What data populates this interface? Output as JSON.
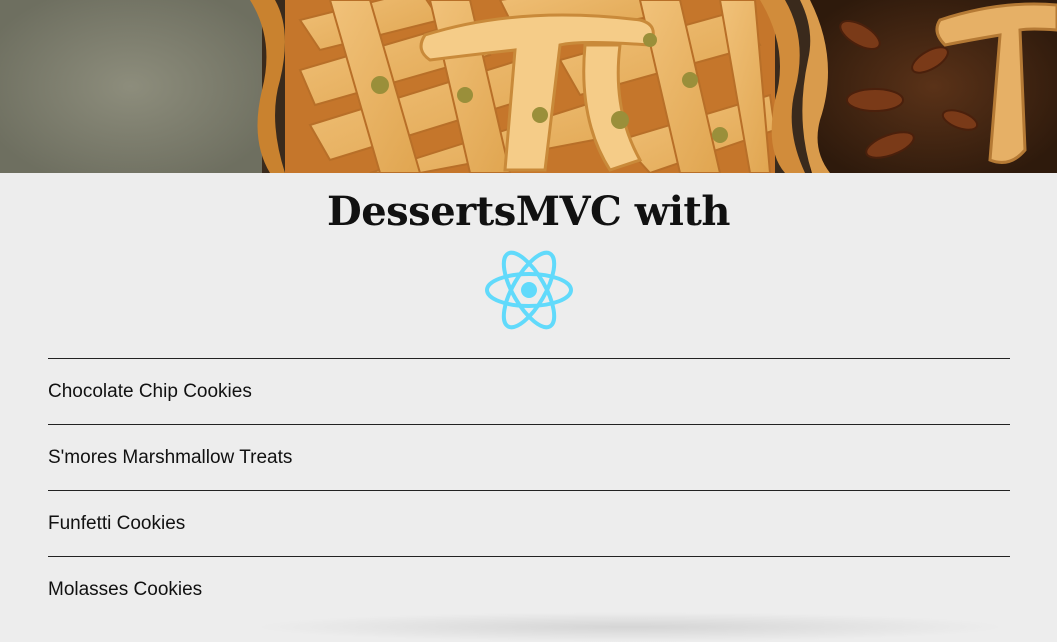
{
  "header": {
    "title": "DessertsMVC with",
    "logo_icon": "react-atom-icon",
    "logo_color": "#61dafb"
  },
  "desserts": [
    {
      "label": "Chocolate Chip Cookies"
    },
    {
      "label": "S'mores Marshmallow Treats"
    },
    {
      "label": "Funfetti Cookies"
    },
    {
      "label": "Molasses Cookies"
    }
  ]
}
